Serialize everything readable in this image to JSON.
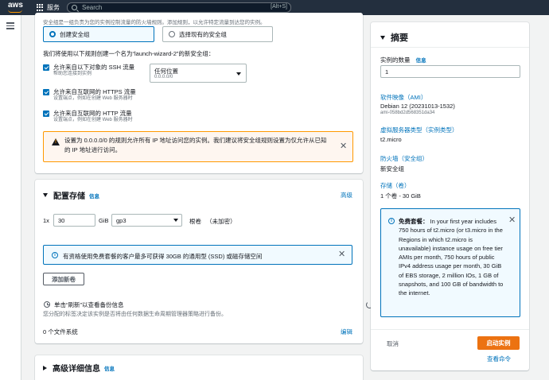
{
  "nav": {
    "logo": "aws",
    "services": "服务",
    "search_placeholder": "Search",
    "search_shortcut": "[Alt+S]"
  },
  "network": {
    "sg_hint": "安全组是一组负责为您的实例控制流量的防火墙规则。添加规则，以允许特定流量到达您的实例。",
    "create_sg": "创建安全组",
    "select_sg": "选择现有的安全组",
    "rules_intro": "我们将使用以下规则创建一个名为“launch-wizard-2”的新安全组：",
    "rules": [
      {
        "title": "允许来自以下对象的 SSH 流量",
        "sub": "帮助您连接到实例",
        "checked": true
      },
      {
        "title": "允许来自互联网的 HTTPS 流量",
        "sub": "设置端点，例如在创建 Web 服务器时",
        "checked": true
      },
      {
        "title": "允许来自互联网的 HTTP 流量",
        "sub": "设置端点，例如在创建 Web 服务器时",
        "checked": true
      }
    ],
    "source_label": "任何位置",
    "source_value": "0.0.0.0/0",
    "warning": "设置为 0.0.0.0/0 的规则允许所有 IP 地址访问您的实例。我们建议将安全组规则设置为仅允许从已知的 IP 地址进行访问。"
  },
  "storage": {
    "title": "配置存储",
    "info": "信息",
    "advanced": "高级",
    "count_prefix": "1x",
    "size": "30",
    "unit": "GiB",
    "volume_type": "gp3",
    "volume_kind": "根卷",
    "encryption": "（未加密）",
    "free_tier_note": "有资格使用免费套餐的客户最多可获得 30GB 的通用型 (SSD) 或磁存储空间",
    "add_volume": "添加新卷",
    "backup_title": "单击“刷新”以查看备份信息",
    "backup_desc": "您分配的标签决定该实例是否将由任何数据生命周期管理器策略进行备份。",
    "fs_count": "0 个文件系统",
    "edit": "编辑"
  },
  "advanced": {
    "title": "高级详细信息",
    "info": "信息"
  },
  "summary": {
    "title": "摘要",
    "instance_count_label": "实例的数量",
    "info": "信息",
    "instance_count": "1",
    "ami_label": "软件映像（AMI）",
    "ami_name": "Debian 12 (20231013-1532)",
    "ami_id": "ami-058bd2d568351da34",
    "type_label": "虚拟服务器类型（实例类型）",
    "type_value": "t2.micro",
    "firewall_label": "防火墙（安全组）",
    "firewall_value": "新安全组",
    "storage_label": "存储（卷）",
    "storage_value": "1 个卷 - 30 GiB",
    "free_tier_bold": "免费套餐：",
    "free_tier_text": "In your first year includes 750 hours of t2.micro (or t3.micro in the Regions in which t2.micro is unavailable) instance usage on free tier AMIs per month, 750 hours of public IPv4 address usage per month, 30 GiB of EBS storage, 2 million IOs, 1 GB of snapshots, and 100 GB of bandwidth to the internet.",
    "cancel": "取消",
    "launch": "启动实例",
    "view_commands": "查看命令"
  },
  "colors": {
    "nav_bg": "#232f3e",
    "link": "#0073bb",
    "primary": "#ec7211",
    "warning": "#ff9900"
  }
}
